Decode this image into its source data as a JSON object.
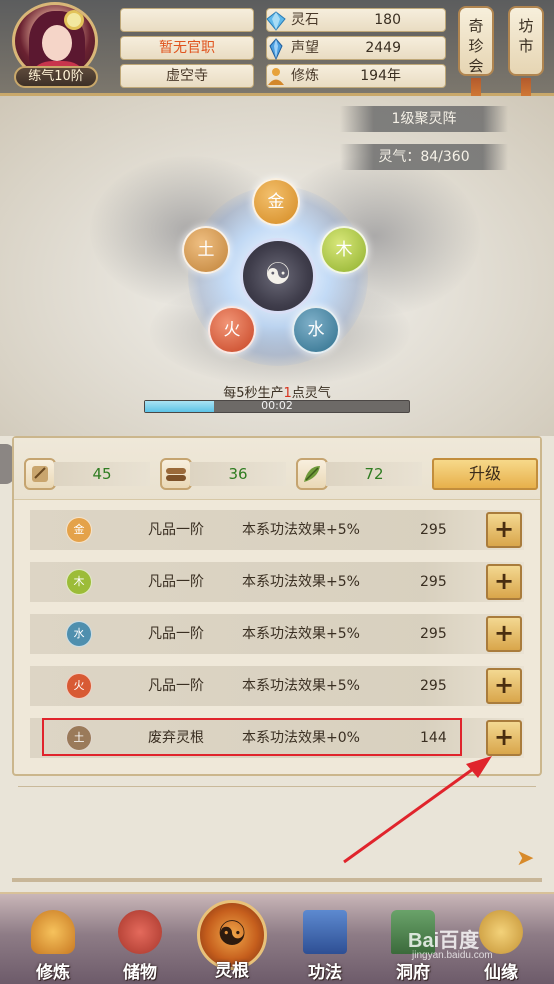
{
  "player": {
    "name": "",
    "rank": "练气10阶",
    "title": "暂无官职",
    "sect": "虚空寺"
  },
  "stats": [
    {
      "icon": "diamond-icon",
      "label": "灵石",
      "value": "180"
    },
    {
      "icon": "crystal-icon",
      "label": "声望",
      "value": "2449"
    },
    {
      "icon": "meditate-icon",
      "label": "修炼",
      "value": "194年"
    }
  ],
  "side_buttons": [
    {
      "label": "奇珍会"
    },
    {
      "label": "坊市"
    }
  ],
  "array": {
    "level_label": "1级聚灵阵",
    "qi_label": "灵气：84/360",
    "center_symbol": "☯",
    "elements": {
      "jin": "金",
      "mu": "木",
      "shui": "水",
      "huo": "火",
      "tu": "土"
    },
    "produce_prefix": "每5秒生产",
    "produce_num": "1",
    "produce_suffix": "点灵气",
    "progress": 0.26,
    "timer": "00:02"
  },
  "resources": [
    {
      "icon": "herb-scroll-icon",
      "value": "45"
    },
    {
      "icon": "wood-log-icon",
      "value": "36"
    },
    {
      "icon": "leaf-herb-icon",
      "value": "72"
    }
  ],
  "upgrade_label": "升级",
  "roots": [
    {
      "element": "金",
      "grade": "凡品一阶",
      "effect": "本系功法效果+5%",
      "cost": "295",
      "color": "#e4a24a"
    },
    {
      "element": "木",
      "grade": "凡品一阶",
      "effect": "本系功法效果+5%",
      "cost": "295",
      "color": "#9cbc38"
    },
    {
      "element": "水",
      "grade": "凡品一阶",
      "effect": "本系功法效果+5%",
      "cost": "295",
      "color": "#4f8fae"
    },
    {
      "element": "火",
      "grade": "凡品一阶",
      "effect": "本系功法效果+5%",
      "cost": "295",
      "color": "#d85a34"
    },
    {
      "element": "土",
      "grade": "废弃灵根",
      "effect": "本系功法效果+0%",
      "cost": "144",
      "color": "#9a7a5a"
    }
  ],
  "plus_label": "+",
  "nav": [
    {
      "label": "修炼",
      "icon": "cultivate-icon"
    },
    {
      "label": "储物",
      "icon": "storage-bag-icon"
    },
    {
      "label": "灵根",
      "icon": "spirit-root-icon"
    },
    {
      "label": "功法",
      "icon": "manual-book-icon"
    },
    {
      "label": "洞府",
      "icon": "cave-house-icon"
    },
    {
      "label": "仙缘",
      "icon": "fortune-icon"
    }
  ],
  "watermark": {
    "main": "Bai百度",
    "sub": "jingyan.baidu.com"
  },
  "colors": {
    "accent_orange": "#e0541e",
    "highlight_red": "#e0242c",
    "value_green": "#2f7c21"
  }
}
